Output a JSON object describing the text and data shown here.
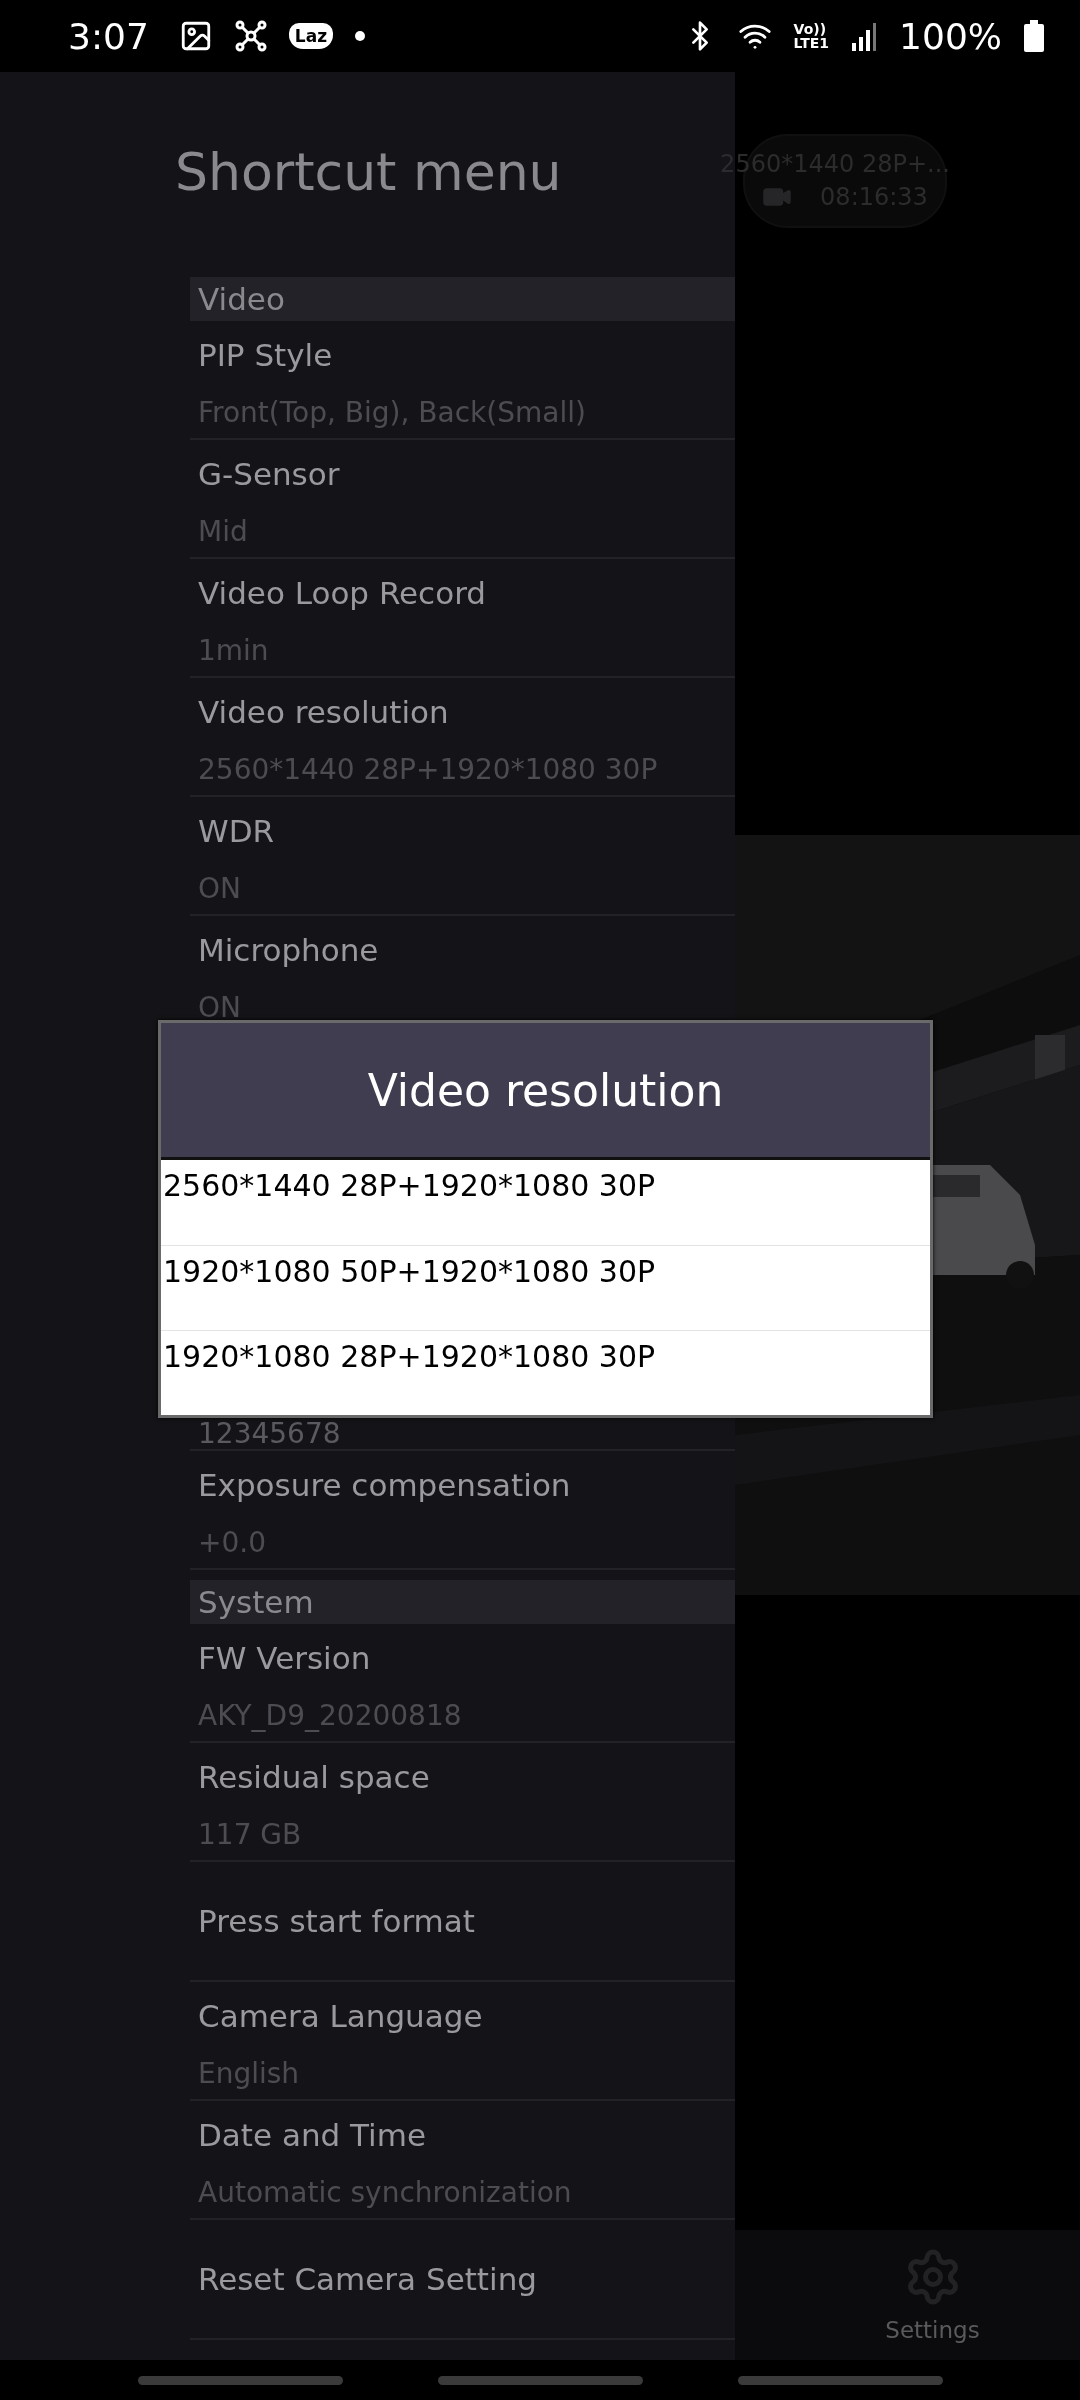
{
  "status_bar": {
    "time": "3:07",
    "app_badge": "Laz",
    "volte": "Vo))",
    "network": "LTE1",
    "battery": "100%"
  },
  "drawer": {
    "title": "Shortcut menu",
    "sections": [
      {
        "header": "Video",
        "items": [
          {
            "kind": "setting",
            "title": "PIP Style",
            "value": "Front(Top, Big), Back(Small)"
          },
          {
            "kind": "setting",
            "title": "G-Sensor",
            "value": "Mid"
          },
          {
            "kind": "setting",
            "title": "Video Loop Record",
            "value": "1min"
          },
          {
            "kind": "setting",
            "title": "Video resolution",
            "value": "2560*1440 28P+1920*1080 30P"
          },
          {
            "kind": "setting",
            "title": "WDR",
            "value": "ON"
          },
          {
            "kind": "setting",
            "title": "Microphone",
            "value": "ON"
          },
          {
            "kind": "partial",
            "value": "12345678"
          },
          {
            "kind": "setting",
            "title": "Exposure compensation",
            "value": "+0.0"
          }
        ]
      },
      {
        "header": "System",
        "items": [
          {
            "kind": "setting",
            "title": "FW Version",
            "value": "AKY_D9_20200818"
          },
          {
            "kind": "setting",
            "title": "Residual space",
            "value": "117 GB"
          },
          {
            "kind": "action",
            "title": "Press start format"
          },
          {
            "kind": "setting",
            "title": "Camera Language",
            "value": "English"
          },
          {
            "kind": "setting",
            "title": "Date and Time",
            "value": "Automatic synchronization"
          },
          {
            "kind": "action",
            "title": "Reset Camera Setting"
          }
        ]
      }
    ]
  },
  "preview": {
    "recording_overlay": {
      "resolution": "2560*1440 28P+...",
      "timer": "08:16:33"
    }
  },
  "bottom_bar": {
    "settings_label": "Settings"
  },
  "dialog": {
    "title": "Video resolution",
    "options": [
      {
        "label": "2560*1440 28P+1920*1080 30P"
      },
      {
        "label": "1920*1080 50P+1920*1080 30P"
      },
      {
        "label": "1920*1080 28P+1920*1080 30P"
      }
    ]
  }
}
